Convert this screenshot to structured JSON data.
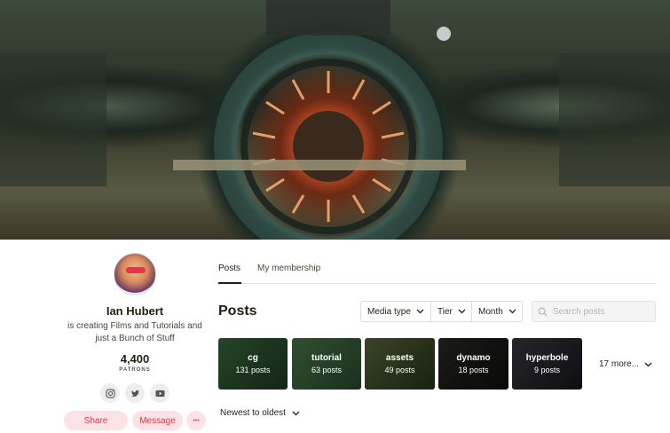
{
  "banner": {
    "description_icon": "banner-image"
  },
  "creator": {
    "name": "Ian Hubert",
    "description": "is creating Films and Tutorials and just a Bunch of Stuff",
    "patron_count": "4,400",
    "patron_label": "PATRONS"
  },
  "social": [
    {
      "icon": "instagram-icon"
    },
    {
      "icon": "twitter-icon"
    },
    {
      "icon": "youtube-icon"
    }
  ],
  "actions": {
    "share_label": "Share",
    "message_label": "Message",
    "more_label": "•••"
  },
  "tabs": [
    {
      "label": "Posts",
      "active": true
    },
    {
      "label": "My membership",
      "active": false
    }
  ],
  "main": {
    "heading": "Posts"
  },
  "filters": [
    {
      "label": "Media type"
    },
    {
      "label": "Tier"
    },
    {
      "label": "Month"
    }
  ],
  "search": {
    "placeholder": "Search posts",
    "value": ""
  },
  "tags": [
    {
      "name": "cg",
      "count": "131 posts",
      "color": "#2f5a34"
    },
    {
      "name": "tutorial",
      "count": "63 posts",
      "color": "#3d6a44"
    },
    {
      "name": "assets",
      "count": "49 posts",
      "color": "#3a5030"
    },
    {
      "name": "dynamo",
      "count": "18 posts",
      "color": "#1a1a18"
    },
    {
      "name": "hyperbole",
      "count": "9 posts",
      "color": "#24242a"
    }
  ],
  "more_tags_label": "17 more...",
  "sort_label": "Newest to oldest",
  "colors": {
    "accent": "#d93a4e",
    "accent_bg": "#fbe3e5",
    "text": "#241e12"
  }
}
